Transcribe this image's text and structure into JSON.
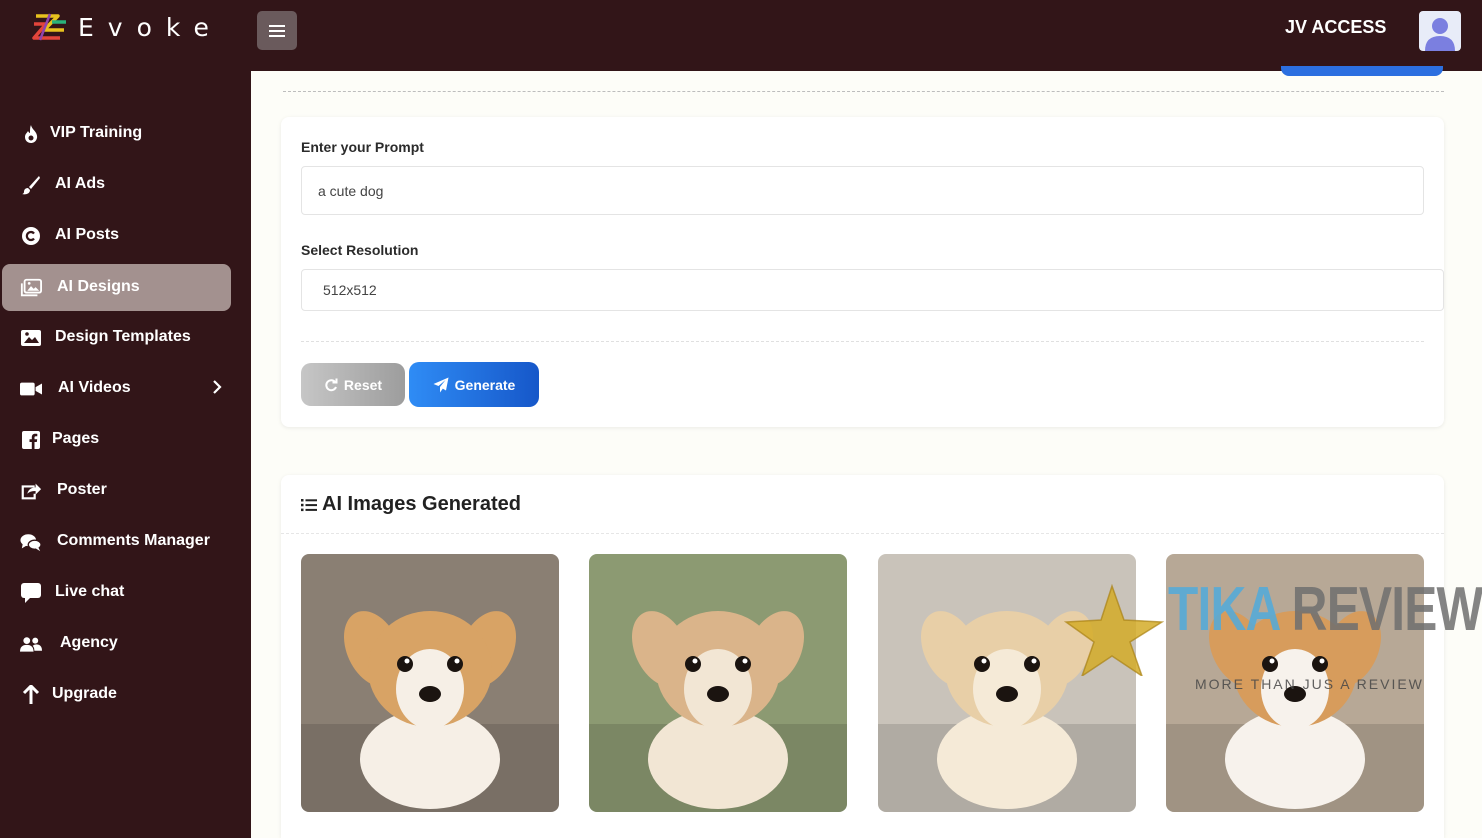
{
  "brand": {
    "name": "Evoke"
  },
  "header": {
    "access_label": "JV ACCESS"
  },
  "sidebar": {
    "items": [
      {
        "label": "VIP Training",
        "icon": "fire-icon"
      },
      {
        "label": "AI Ads",
        "icon": "brush-icon"
      },
      {
        "label": "AI Posts",
        "icon": "copyright-icon"
      },
      {
        "label": "AI Designs",
        "icon": "images-icon",
        "active": true
      },
      {
        "label": "Design Templates",
        "icon": "image-icon"
      },
      {
        "label": "AI Videos",
        "icon": "video-icon",
        "has_submenu": true
      },
      {
        "label": "Pages",
        "icon": "facebook-icon"
      },
      {
        "label": "Poster",
        "icon": "share-icon"
      },
      {
        "label": "Comments Manager",
        "icon": "comments-icon"
      },
      {
        "label": "Live chat",
        "icon": "chat-icon"
      },
      {
        "label": "Agency",
        "icon": "users-icon"
      },
      {
        "label": "Upgrade",
        "icon": "arrow-up-icon"
      }
    ]
  },
  "form": {
    "prompt_label": "Enter your Prompt",
    "prompt_value": "a cute dog",
    "resolution_label": "Select Resolution",
    "resolution_value": "512x512",
    "reset_label": "Reset",
    "generate_label": "Generate"
  },
  "gallery": {
    "title": "AI Images Generated",
    "images": [
      {
        "alt": "puppy-1",
        "bg": "#8a7f73",
        "fur": "#d8a365",
        "face": "#f6efe6"
      },
      {
        "alt": "puppy-2",
        "bg": "#8c9a72",
        "fur": "#dab48a",
        "face": "#f2e6d4"
      },
      {
        "alt": "puppy-3",
        "bg": "#c9c3ba",
        "fur": "#e8cfa7",
        "face": "#f5ead7"
      },
      {
        "alt": "puppy-4",
        "bg": "#b7a896",
        "fur": "#d79c5c",
        "face": "#f7f2ec"
      }
    ]
  },
  "watermark": {
    "word1": "TIKA",
    "word2": "REVIEW",
    "tagline": "MORE THAN JUS A REVIEW"
  },
  "colors": {
    "sidebar_bg": "#321518",
    "active_item": "#a3918f",
    "primary": "#1f6ee0",
    "page_bg": "#fdfdf8"
  }
}
